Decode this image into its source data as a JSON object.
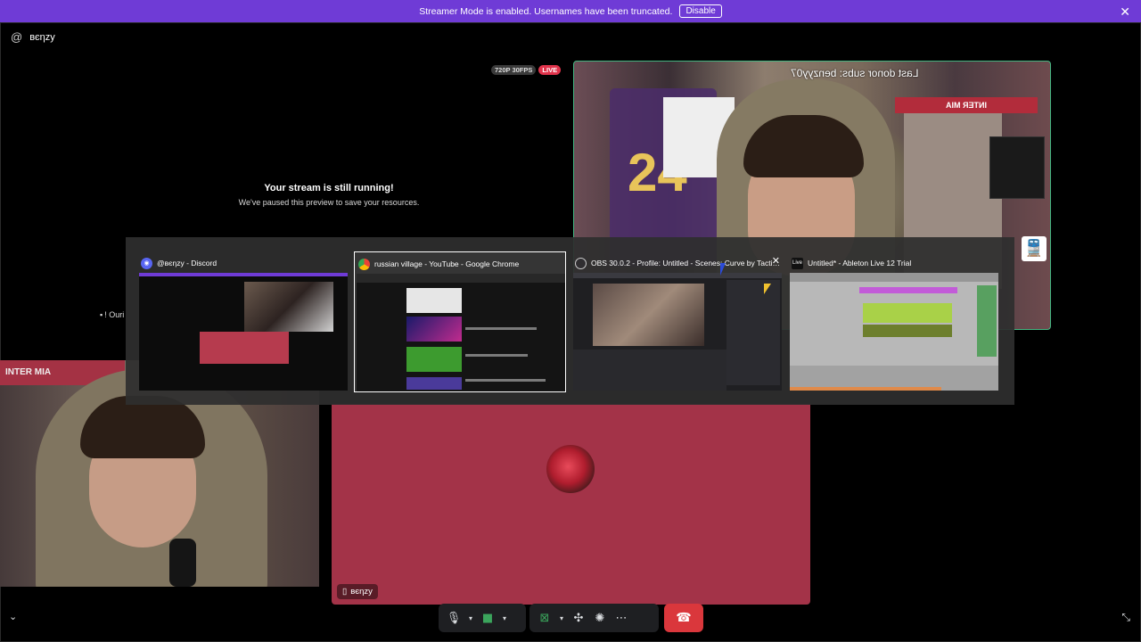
{
  "banner": {
    "message": "Streamer Mode is enabled. Usernames have been truncated.",
    "disable_label": "Disable",
    "close_icon": "close-icon",
    "color": "#6f3bd6"
  },
  "channel": {
    "username": "вєηzу",
    "icon": "at-sign-icon"
  },
  "stream_badges": {
    "quality": "720P 30FPS",
    "live": "LIVE"
  },
  "stream_paused": {
    "title": "Your stream is still running!",
    "subtitle": "We've paused this preview to save your resources."
  },
  "stream_overlay": {
    "donor_text": "Last donor subs: benzyy07",
    "banner_text": "INTER MIA"
  },
  "window_switcher": {
    "windows": [
      {
        "title": "@вєηzу - Discord",
        "icon": "discord-icon",
        "active": false
      },
      {
        "title": "russian village - YouTube - Google Chrome",
        "icon": "chrome-icon",
        "active": true
      },
      {
        "title": "OBS 30.0.2 - Profile: Untitled - Scenes: Curve by Tactic...",
        "icon": "obs-icon",
        "active": false
      },
      {
        "title": "Untitled* - Ableton Live 12 Trial",
        "icon": "ableton-icon",
        "active": false
      }
    ]
  },
  "side_label": {
    "text": "! Ouri"
  },
  "local_camera": {
    "banner_text": "INTER MIA"
  },
  "voice_tile": {
    "name": "вєηzу",
    "device_icon": "mobile-phone-icon",
    "color": "#a33348"
  },
  "controls": {
    "collapse_icon": "chevron-down-icon",
    "mic_icon": "microphone-icon",
    "camera_icon": "video-camera-icon",
    "screenshare_icon": "screen-share-icon",
    "activities_icon": "activities-icon",
    "soundboard_icon": "soundboard-icon",
    "more_icon": "more-icon",
    "end_call_icon": "hang-up-icon",
    "fullscreen_icon": "fullscreen-exit-icon",
    "end_call_color": "#da373c"
  }
}
